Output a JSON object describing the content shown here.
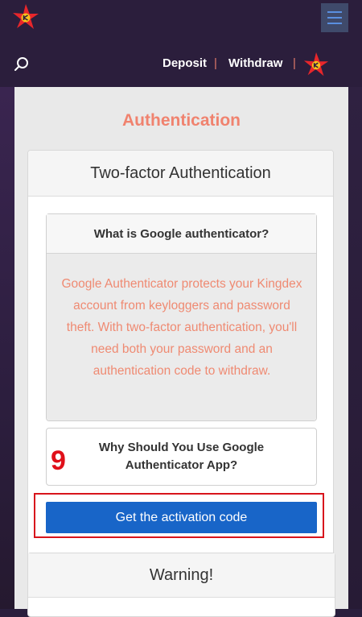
{
  "nav": {
    "deposit": "Deposit",
    "separator": "|",
    "withdraw": "Withdraw",
    "icons": [
      "logo-icon",
      "menu-icon",
      "search-icon",
      "avatar-icon"
    ]
  },
  "page": {
    "title": "Authentication"
  },
  "card": {
    "title": "Two-factor Authentication",
    "accordion": [
      {
        "heading": "What is Google authenticator?",
        "body": "Google Authenticator protects your Kingdex account from keyloggers and password theft. With two-factor authentication, you'll need both your password and an authentication code to withdraw.",
        "expanded": true
      },
      {
        "heading": "Why Should You Use Google Authenticator App?",
        "expanded": false
      }
    ],
    "button_label": "Get the activation code"
  },
  "annotation": {
    "step": "9"
  },
  "warning": {
    "title": "Warning!"
  },
  "colors": {
    "header_bg": "#2b1e3c",
    "accent": "#f0826e",
    "primary": "#1865c8",
    "annotation": "#d8141c"
  }
}
